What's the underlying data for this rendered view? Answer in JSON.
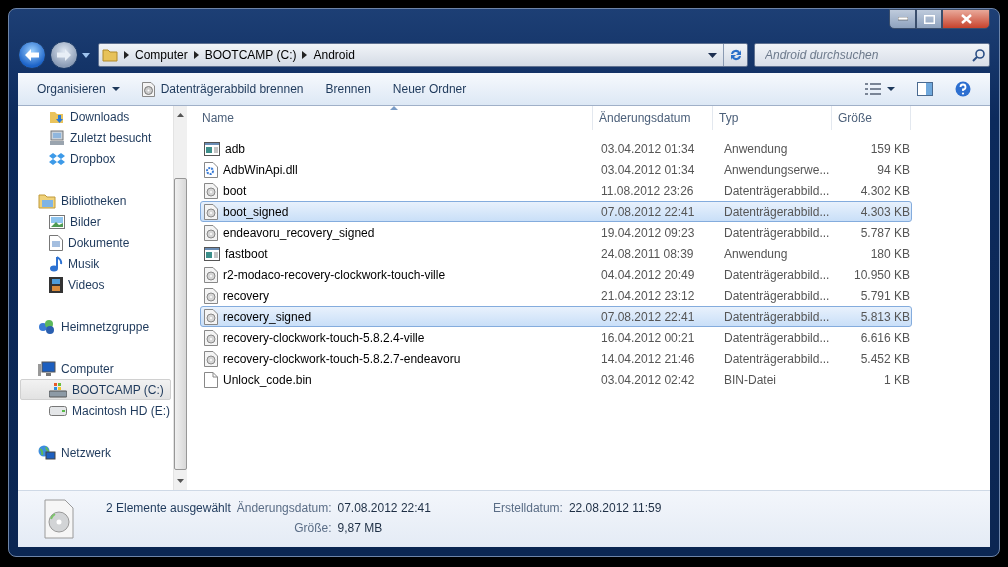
{
  "address": {
    "segments": [
      "Computer",
      "BOOTCAMP (C:)",
      "Android"
    ]
  },
  "search": {
    "placeholder": "Android durchsuchen"
  },
  "toolbar": {
    "buttons": [
      {
        "label": "Organisieren",
        "kind": "menu"
      },
      {
        "label": "Datenträgerabbild brennen",
        "kind": "icon"
      },
      {
        "label": "Brennen",
        "kind": "plain"
      },
      {
        "label": "Neuer Ordner",
        "kind": "plain"
      }
    ]
  },
  "sidebar": {
    "groups": [
      {
        "children": [
          {
            "label": "Downloads",
            "kind": "downloads",
            "selected": false
          },
          {
            "label": "Zuletzt besucht",
            "kind": "recent",
            "selected": false
          },
          {
            "label": "Dropbox",
            "kind": "dropbox",
            "selected": false
          }
        ]
      },
      {
        "label": "Bibliotheken",
        "kind": "library",
        "selected": false,
        "children": [
          {
            "label": "Bilder",
            "kind": "pictures",
            "selected": false
          },
          {
            "label": "Dokumente",
            "kind": "documents",
            "selected": false
          },
          {
            "label": "Musik",
            "kind": "music",
            "selected": false
          },
          {
            "label": "Videos",
            "kind": "videos",
            "selected": false
          }
        ]
      },
      {
        "label": "Heimnetzgruppe",
        "kind": "homegroup",
        "selected": false
      },
      {
        "label": "Computer",
        "kind": "computer",
        "selected": false,
        "children": [
          {
            "label": "BOOTCAMP (C:)",
            "kind": "system-drive",
            "selected": true
          },
          {
            "label": "Macintosh HD (E:)",
            "kind": "drive",
            "selected": false
          }
        ]
      },
      {
        "label": "Netzwerk",
        "kind": "network",
        "selected": false
      }
    ]
  },
  "table": {
    "columns": [
      {
        "label": "Name",
        "sorted": true
      },
      {
        "label": "Änderungsdatum",
        "sorted": false
      },
      {
        "label": "Typ",
        "sorted": false
      },
      {
        "label": "Größe",
        "sorted": false
      }
    ],
    "rows": [
      {
        "name": "adb",
        "date": "03.04.2012 01:34",
        "type": "Anwendung",
        "size": "159 KB",
        "kind": "application",
        "selected": false
      },
      {
        "name": "AdbWinApi.dll",
        "date": "03.04.2012 01:34",
        "type": "Anwendungserwe...",
        "size": "94 KB",
        "kind": "extension",
        "selected": false
      },
      {
        "name": "boot",
        "date": "11.08.2012 23:26",
        "type": "Datenträgerabbild...",
        "size": "4.302 KB",
        "kind": "disk-image",
        "selected": false
      },
      {
        "name": "boot_signed",
        "date": "07.08.2012 22:41",
        "type": "Datenträgerabbild...",
        "size": "4.303 KB",
        "kind": "disk-image",
        "selected": true
      },
      {
        "name": "endeavoru_recovery_signed",
        "date": "19.04.2012 09:23",
        "type": "Datenträgerabbild...",
        "size": "5.787 KB",
        "kind": "disk-image",
        "selected": false
      },
      {
        "name": "fastboot",
        "date": "24.08.2011 08:39",
        "type": "Anwendung",
        "size": "180 KB",
        "kind": "application",
        "selected": false
      },
      {
        "name": "r2-modaco-recovery-clockwork-touch-ville",
        "date": "04.04.2012 20:49",
        "type": "Datenträgerabbild...",
        "size": "10.950 KB",
        "kind": "disk-image",
        "selected": false
      },
      {
        "name": "recovery",
        "date": "21.04.2012 23:12",
        "type": "Datenträgerabbild...",
        "size": "5.791 KB",
        "kind": "disk-image",
        "selected": false
      },
      {
        "name": "recovery_signed",
        "date": "07.08.2012 22:41",
        "type": "Datenträgerabbild...",
        "size": "5.813 KB",
        "kind": "disk-image",
        "selected": true
      },
      {
        "name": "recovery-clockwork-touch-5.8.2.4-ville",
        "date": "16.04.2012 00:21",
        "type": "Datenträgerabbild...",
        "size": "6.616 KB",
        "kind": "disk-image",
        "selected": false
      },
      {
        "name": "recovery-clockwork-touch-5.8.2.7-endeavoru",
        "date": "14.04.2012 21:46",
        "type": "Datenträgerabbild...",
        "size": "5.452 KB",
        "kind": "disk-image",
        "selected": false
      },
      {
        "name": "Unlock_code.bin",
        "date": "03.04.2012 02:42",
        "type": "BIN-Datei",
        "size": "1 KB",
        "kind": "file",
        "selected": false
      }
    ]
  },
  "details": {
    "summary": "2 Elemente ausgewählt",
    "columns": [
      [
        {
          "label": "Änderungsdatum:",
          "value": "07.08.2012 22:41"
        },
        {
          "label": "Größe:",
          "value": "9,87 MB"
        }
      ],
      [
        {
          "label": "Erstelldatum:",
          "value": "22.08.2012 11:59"
        }
      ]
    ]
  }
}
